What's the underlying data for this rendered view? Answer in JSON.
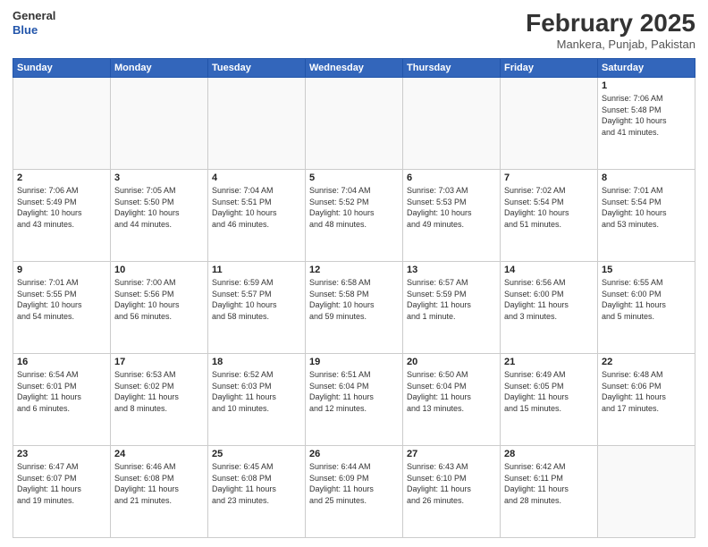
{
  "header": {
    "logo_line1": "General",
    "logo_line2": "Blue",
    "month_title": "February 2025",
    "location": "Mankera, Punjab, Pakistan"
  },
  "weekdays": [
    "Sunday",
    "Monday",
    "Tuesday",
    "Wednesday",
    "Thursday",
    "Friday",
    "Saturday"
  ],
  "weeks": [
    [
      {
        "day": "",
        "info": ""
      },
      {
        "day": "",
        "info": ""
      },
      {
        "day": "",
        "info": ""
      },
      {
        "day": "",
        "info": ""
      },
      {
        "day": "",
        "info": ""
      },
      {
        "day": "",
        "info": ""
      },
      {
        "day": "1",
        "info": "Sunrise: 7:06 AM\nSunset: 5:48 PM\nDaylight: 10 hours\nand 41 minutes."
      }
    ],
    [
      {
        "day": "2",
        "info": "Sunrise: 7:06 AM\nSunset: 5:49 PM\nDaylight: 10 hours\nand 43 minutes."
      },
      {
        "day": "3",
        "info": "Sunrise: 7:05 AM\nSunset: 5:50 PM\nDaylight: 10 hours\nand 44 minutes."
      },
      {
        "day": "4",
        "info": "Sunrise: 7:04 AM\nSunset: 5:51 PM\nDaylight: 10 hours\nand 46 minutes."
      },
      {
        "day": "5",
        "info": "Sunrise: 7:04 AM\nSunset: 5:52 PM\nDaylight: 10 hours\nand 48 minutes."
      },
      {
        "day": "6",
        "info": "Sunrise: 7:03 AM\nSunset: 5:53 PM\nDaylight: 10 hours\nand 49 minutes."
      },
      {
        "day": "7",
        "info": "Sunrise: 7:02 AM\nSunset: 5:54 PM\nDaylight: 10 hours\nand 51 minutes."
      },
      {
        "day": "8",
        "info": "Sunrise: 7:01 AM\nSunset: 5:54 PM\nDaylight: 10 hours\nand 53 minutes."
      }
    ],
    [
      {
        "day": "9",
        "info": "Sunrise: 7:01 AM\nSunset: 5:55 PM\nDaylight: 10 hours\nand 54 minutes."
      },
      {
        "day": "10",
        "info": "Sunrise: 7:00 AM\nSunset: 5:56 PM\nDaylight: 10 hours\nand 56 minutes."
      },
      {
        "day": "11",
        "info": "Sunrise: 6:59 AM\nSunset: 5:57 PM\nDaylight: 10 hours\nand 58 minutes."
      },
      {
        "day": "12",
        "info": "Sunrise: 6:58 AM\nSunset: 5:58 PM\nDaylight: 10 hours\nand 59 minutes."
      },
      {
        "day": "13",
        "info": "Sunrise: 6:57 AM\nSunset: 5:59 PM\nDaylight: 11 hours\nand 1 minute."
      },
      {
        "day": "14",
        "info": "Sunrise: 6:56 AM\nSunset: 6:00 PM\nDaylight: 11 hours\nand 3 minutes."
      },
      {
        "day": "15",
        "info": "Sunrise: 6:55 AM\nSunset: 6:00 PM\nDaylight: 11 hours\nand 5 minutes."
      }
    ],
    [
      {
        "day": "16",
        "info": "Sunrise: 6:54 AM\nSunset: 6:01 PM\nDaylight: 11 hours\nand 6 minutes."
      },
      {
        "day": "17",
        "info": "Sunrise: 6:53 AM\nSunset: 6:02 PM\nDaylight: 11 hours\nand 8 minutes."
      },
      {
        "day": "18",
        "info": "Sunrise: 6:52 AM\nSunset: 6:03 PM\nDaylight: 11 hours\nand 10 minutes."
      },
      {
        "day": "19",
        "info": "Sunrise: 6:51 AM\nSunset: 6:04 PM\nDaylight: 11 hours\nand 12 minutes."
      },
      {
        "day": "20",
        "info": "Sunrise: 6:50 AM\nSunset: 6:04 PM\nDaylight: 11 hours\nand 13 minutes."
      },
      {
        "day": "21",
        "info": "Sunrise: 6:49 AM\nSunset: 6:05 PM\nDaylight: 11 hours\nand 15 minutes."
      },
      {
        "day": "22",
        "info": "Sunrise: 6:48 AM\nSunset: 6:06 PM\nDaylight: 11 hours\nand 17 minutes."
      }
    ],
    [
      {
        "day": "23",
        "info": "Sunrise: 6:47 AM\nSunset: 6:07 PM\nDaylight: 11 hours\nand 19 minutes."
      },
      {
        "day": "24",
        "info": "Sunrise: 6:46 AM\nSunset: 6:08 PM\nDaylight: 11 hours\nand 21 minutes."
      },
      {
        "day": "25",
        "info": "Sunrise: 6:45 AM\nSunset: 6:08 PM\nDaylight: 11 hours\nand 23 minutes."
      },
      {
        "day": "26",
        "info": "Sunrise: 6:44 AM\nSunset: 6:09 PM\nDaylight: 11 hours\nand 25 minutes."
      },
      {
        "day": "27",
        "info": "Sunrise: 6:43 AM\nSunset: 6:10 PM\nDaylight: 11 hours\nand 26 minutes."
      },
      {
        "day": "28",
        "info": "Sunrise: 6:42 AM\nSunset: 6:11 PM\nDaylight: 11 hours\nand 28 minutes."
      },
      {
        "day": "",
        "info": ""
      }
    ]
  ]
}
